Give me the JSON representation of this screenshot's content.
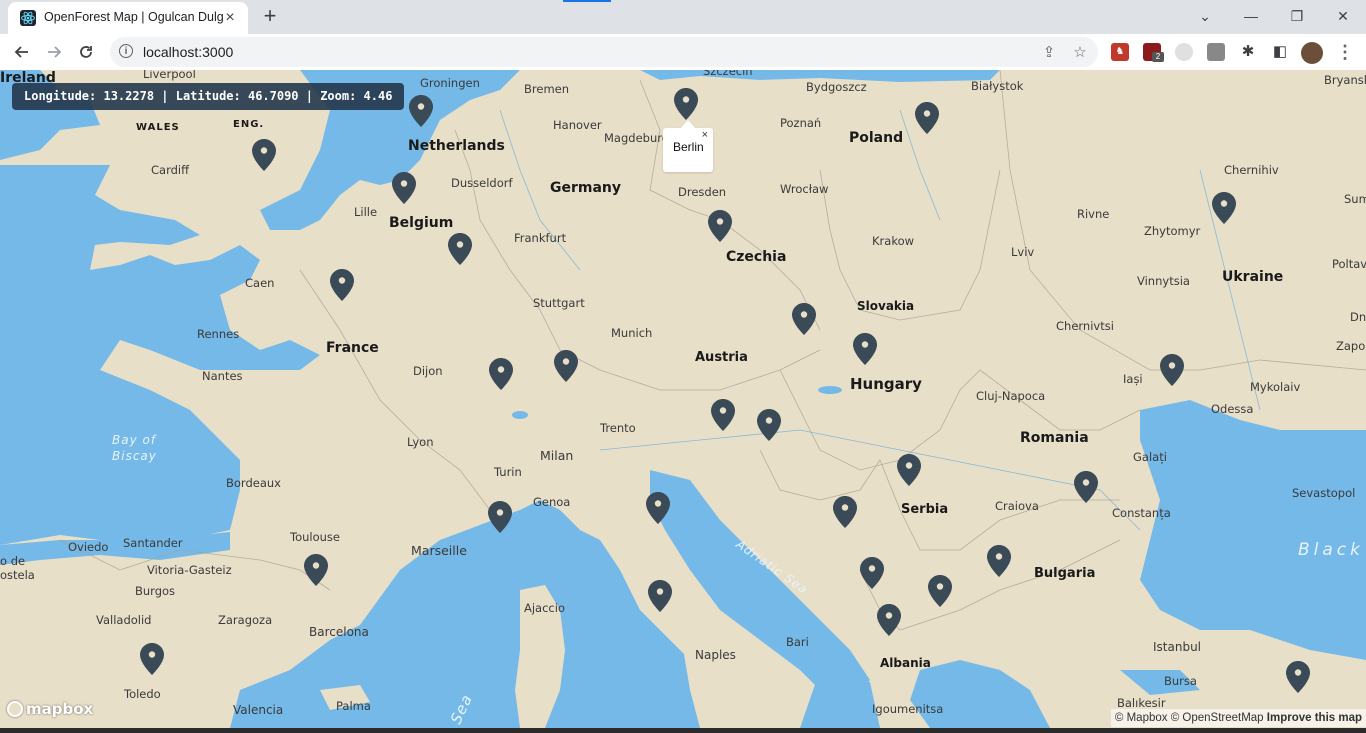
{
  "browser": {
    "tab_title": "OpenForest Map | Ogulcan Dulger",
    "tab_close": "×",
    "new_tab": "+",
    "url": "localhost:3000",
    "window_controls": {
      "dropdown": "⌄",
      "minimize": "—",
      "restore": "❐",
      "close": "✕"
    },
    "extension_badge": "2"
  },
  "map": {
    "coordinates_text": "Longitude: 13.2278 | Latitude: 46.7090 | Zoom: 4.46",
    "popup": {
      "label": "Berlin",
      "close": "×"
    },
    "logo": "mapbox",
    "attribution": {
      "mapbox": "© Mapbox",
      "osm": "© OpenStreetMap",
      "improve": "Improve this map"
    },
    "colors": {
      "land": "#e8dfc9",
      "water": "#75b9e8",
      "marker": "#3b4a57",
      "coord_box": "#23374b"
    },
    "countries": [
      "Ireland",
      "Netherlands",
      "Belgium",
      "Germany",
      "Poland",
      "Czechia",
      "Slovakia",
      "France",
      "Austria",
      "Hungary",
      "Ukraine",
      "Romania",
      "Serbia",
      "Bulgaria",
      "Albania"
    ],
    "small_regions": [
      "WALES",
      "ENG."
    ],
    "cities": [
      "Liverpool",
      "Groningen",
      "Bremen",
      "Szczecin",
      "Bydgoszcz",
      "Białystok",
      "Bryansk",
      "Cardiff",
      "Hanover",
      "Magdeburg",
      "Poznań",
      "Dusseldorf",
      "Dresden",
      "Wrocław",
      "Chernihiv",
      "Lille",
      "Rivne",
      "Zhytomyr",
      "Frankfurt",
      "Krakow",
      "Lviv",
      "Caen",
      "Stuttgart",
      "Vinnytsia",
      "Poltava",
      "Rennes",
      "Munich",
      "Chernivtsi",
      "Nantes",
      "Dijon",
      "Iași",
      "Mykolaiv",
      "Lyon",
      "Trento",
      "Cluj-Napoca",
      "Odessa",
      "Turin",
      "Milan",
      "Galați",
      "Bordeaux",
      "Genoa",
      "Sevastopol",
      "Oviedo",
      "Santander",
      "Toulouse",
      "Craiova",
      "Constanța",
      "Marseille",
      "Vitoria-Gasteiz",
      "Burgos",
      "Valladolid",
      "Zaragoza",
      "Barcelona",
      "Ajaccio",
      "Bari",
      "Istanbul",
      "Toledo",
      "Naples",
      "Bursa",
      "Valencia",
      "Palma",
      "Igoumenitsa",
      "Balıkesir",
      "Zapor",
      "Dni",
      "Sum",
      "o de",
      "ostela"
    ],
    "water_labels": [
      "Bay of",
      "Biscay",
      "Adriatic Sea",
      "Black S",
      "Sea"
    ]
  }
}
